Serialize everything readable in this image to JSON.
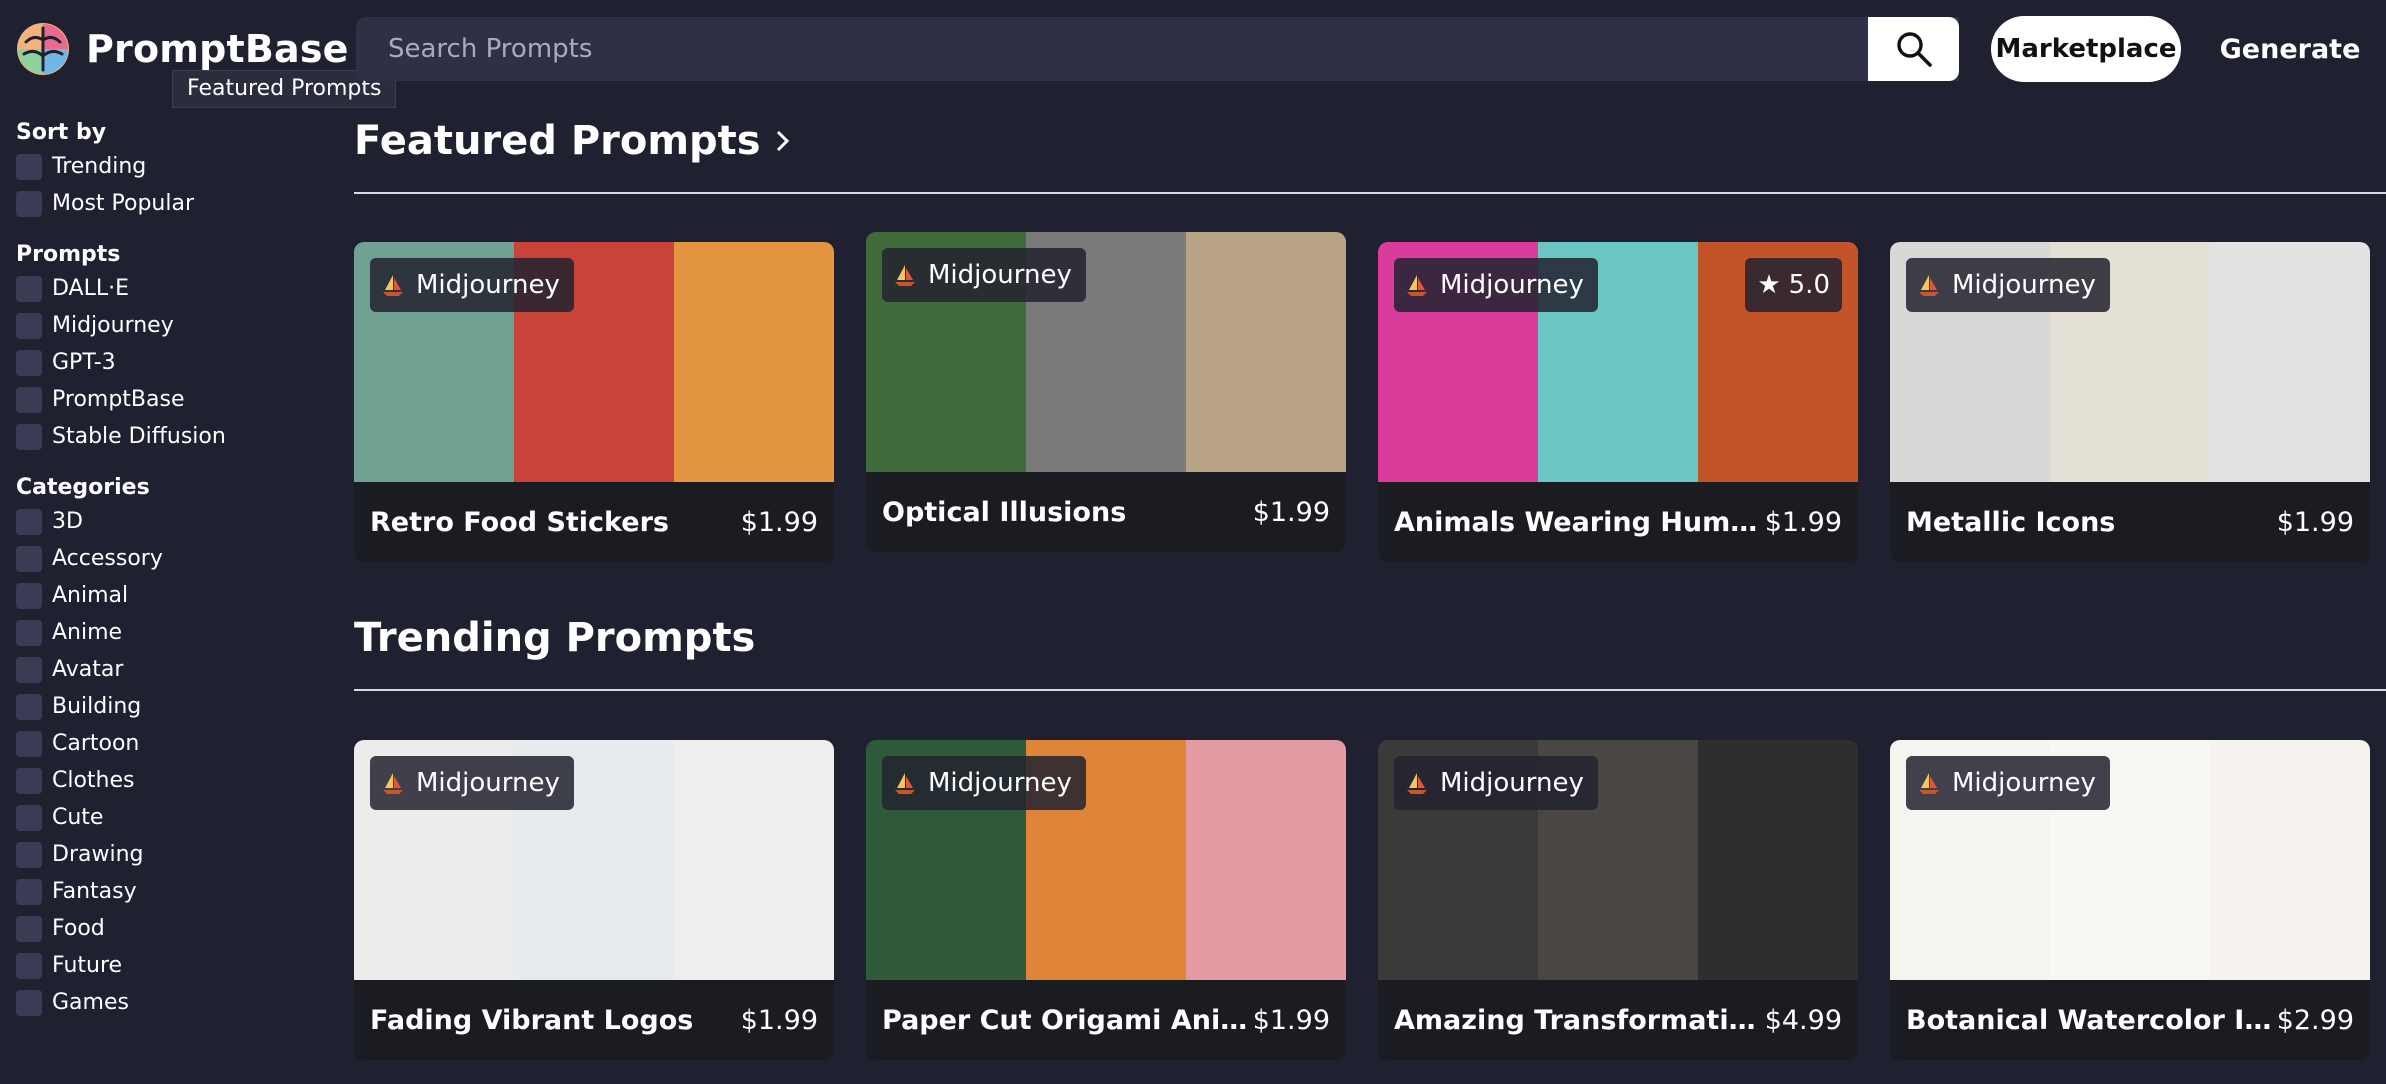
{
  "header": {
    "logo_text": "PromptBase",
    "tooltip": "Featured Prompts",
    "search_placeholder": "Search Prompts",
    "nav_marketplace": "Marketplace",
    "nav_generate": "Generate"
  },
  "sidebar": {
    "sort": {
      "title": "Sort by",
      "items": [
        "Trending",
        "Most Popular"
      ]
    },
    "prompts": {
      "title": "Prompts",
      "items": [
        "DALL·E",
        "Midjourney",
        "GPT-3",
        "PromptBase",
        "Stable Diffusion"
      ]
    },
    "categories": {
      "title": "Categories",
      "items": [
        "3D",
        "Accessory",
        "Animal",
        "Anime",
        "Avatar",
        "Building",
        "Cartoon",
        "Clothes",
        "Cute",
        "Drawing",
        "Fantasy",
        "Food",
        "Future",
        "Games"
      ]
    }
  },
  "featured": {
    "title": "Featured Prompts",
    "cards": [
      {
        "badge": "Midjourney",
        "name": "Retro Food Stickers",
        "price": "$1.99",
        "rating": "",
        "colors": [
          "#6fa092",
          "#c8443a",
          "#e3963f"
        ]
      },
      {
        "badge": "Midjourney",
        "name": "Optical Illusions",
        "price": "$1.99",
        "rating": "",
        "colors": [
          "#3f6a3b",
          "#7a7a7a",
          "#b8a386"
        ]
      },
      {
        "badge": "Midjourney",
        "name": "Animals Wearing Human Cloth...",
        "price": "$1.99",
        "rating": "5.0",
        "colors": [
          "#d93c9a",
          "#6cc6c4",
          "#c3542a"
        ]
      },
      {
        "badge": "Midjourney",
        "name": "Metallic Icons",
        "price": "$1.99",
        "rating": "",
        "colors": [
          "#d8d8d8",
          "#e5e0d6",
          "#e2e2e2"
        ]
      }
    ]
  },
  "trending": {
    "title": "Trending Prompts",
    "cards": [
      {
        "badge": "Midjourney",
        "name": "Fading Vibrant Logos",
        "price": "$1.99",
        "colors": [
          "#ececec",
          "#e8ebee",
          "#eeeeee"
        ]
      },
      {
        "badge": "Midjourney",
        "name": "Paper Cut Origami Animals",
        "price": "$1.99",
        "colors": [
          "#2f5a3a",
          "#e0843a",
          "#e29aa3"
        ]
      },
      {
        "badge": "Midjourney",
        "name": "Amazing Transformation Mak...",
        "price": "$4.99",
        "colors": [
          "#3a3a3a",
          "#4a4642",
          "#2e2e2e"
        ]
      },
      {
        "badge": "Midjourney",
        "name": "Botanical Watercolor Illustrati...",
        "price": "$2.99",
        "colors": [
          "#f6f4ef",
          "#f8f7f3",
          "#f6f3ee"
        ]
      }
    ]
  }
}
